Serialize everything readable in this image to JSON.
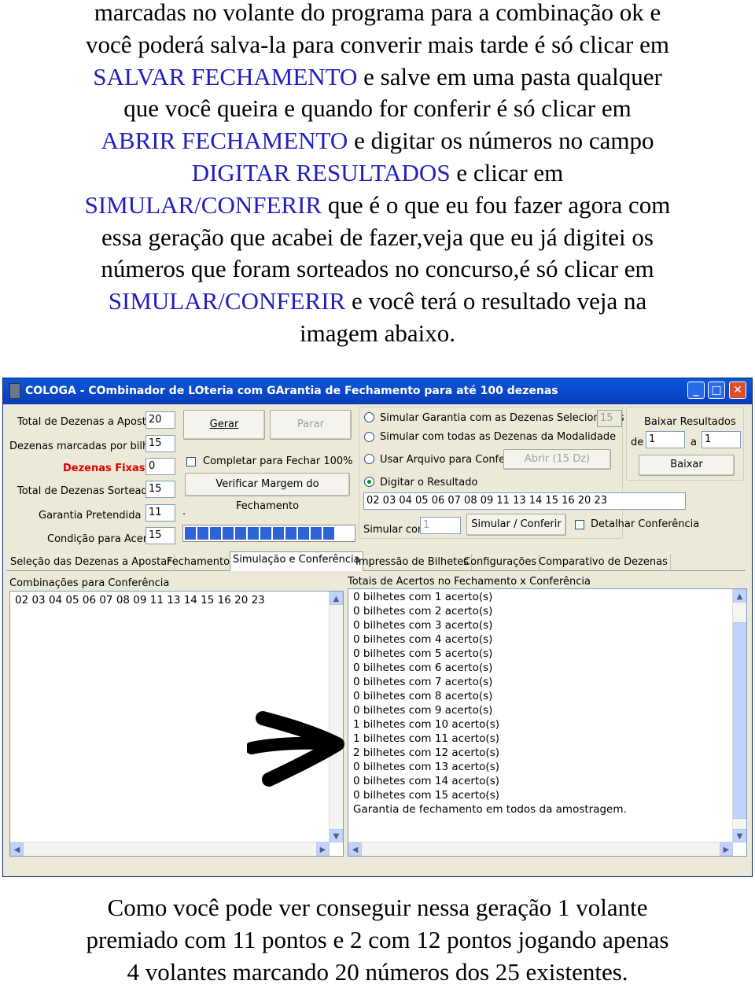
{
  "text_top": {
    "l1": "marcadas no volante do programa para a combinação ok e",
    "l2": "você poderá salva-la para converir mais tarde é só clicar em",
    "l3_link": "SALVAR FECHAMENTO",
    "l3": " e salve em uma pasta qualquer",
    "l4": "que você queira e quando for conferir é só clicar em",
    "l5_link": "ABRIR FECHAMENTO",
    "l5": " e digitar os números no campo",
    "l6_link": "DIGITAR RESULTADOS",
    "l6": " e clicar em",
    "l7_link": "SIMULAR/CONFERIR",
    "l7": " que é o que eu fou fazer agora com",
    "l8": "essa geração que acabei de fazer,veja que eu já digitei os",
    "l9": "números que foram sorteados no concurso,é só clicar em",
    "l10_link": "SIMULAR/CONFERIR",
    "l10": " e você terá o resultado veja na",
    "l11": "imagem abaixo."
  },
  "window": {
    "title": "COLOGA - COmbinador de LOteria com GArantia de Fechamento para até 100 dezenas",
    "minimize": "_",
    "maximize": "□",
    "close": "✕",
    "params": [
      {
        "label": "Total de Dezenas a Apostar",
        "value": "20"
      },
      {
        "label": "Dezenas marcadas por bilhete",
        "value": "15"
      },
      {
        "label": "Dezenas Fixas",
        "value": "0"
      },
      {
        "label": "Total de Dezenas Sorteadas",
        "value": "15"
      },
      {
        "label": "Garantia Pretendida >=",
        "value": "11"
      },
      {
        "label": "Condição para Acerto",
        "value": "15"
      }
    ],
    "dot": ".",
    "gerar": "Gerar",
    "parar": "Parar",
    "completar": "Completar para Fechar 100%",
    "verificar": "Verificar Margem do Fechamento",
    "progress_segments": 12,
    "opt_sim_selecionadas": "Simular Garantia com as Dezenas Selecionadas",
    "opt_sim_selecionadas_value": "15",
    "opt_sim_todas": "Simular com todas as Dezenas da Modalidade",
    "opt_usar_arquivo": "Usar Arquivo para Conferir",
    "abrir_btn": "Abrir (15 Dz)",
    "opt_digitar": "Digitar o Resultado",
    "resultado": "02 03 04 05 06 07 08 09 11 13 14 15 16 20 23",
    "simular_com": "Simular com",
    "simular_com_value": "1",
    "simular_btn": "Simular / Conferir",
    "detalhar": "Detalhar Conferência",
    "baixar_title": "Baixar Resultados",
    "de": "de",
    "de_value": "1",
    "a": "a",
    "a_value": "1",
    "baixar_btn": "Baixar",
    "tabs": [
      "Seleção das Dezenas a Apostar",
      "Fechamento",
      "Simulação e Conferência",
      "Impressão de Bilhetes",
      "Configurações",
      "Comparativo de Dezenas"
    ],
    "left_list_title": "Combinações para Conferência",
    "left_list": [
      "02 03 04 05 06 07 08 09 11 13 14 15 16 20 23"
    ],
    "right_list_title": "Totais de Acertos no Fechamento x Conferência",
    "right_list": [
      "0 bilhetes com 1 acerto(s)",
      "0 bilhetes com 2 acerto(s)",
      "0 bilhetes com 3 acerto(s)",
      "0 bilhetes com 4 acerto(s)",
      "0 bilhetes com 5 acerto(s)",
      "0 bilhetes com 6 acerto(s)",
      "0 bilhetes com 7 acerto(s)",
      "0 bilhetes com 8 acerto(s)",
      "0 bilhetes com 9 acerto(s)",
      "1 bilhetes com 10 acerto(s)",
      "1 bilhetes com 11 acerto(s)",
      "2 bilhetes com 12 acerto(s)",
      "0 bilhetes com 13 acerto(s)",
      "0 bilhetes com 14 acerto(s)",
      "0 bilhetes com 15 acerto(s)",
      "Garantia de fechamento em todos da amostragem."
    ],
    "arrow_up": "▲",
    "arrow_down": "▼",
    "arrow_left": "◀",
    "arrow_right": "▶"
  },
  "text_bottom": {
    "l1": "Como você pode ver conseguir nessa geração 1 volante",
    "l2": "premiado com 11 pontos e 2 com 12 pontos jogando apenas",
    "l3": "4 volantes marcando 20 números dos 25 existentes."
  },
  "colors": {
    "link_blue": "#1f1fbf",
    "fixas_red": "#e00000",
    "titlebar": "#0a46c8"
  }
}
